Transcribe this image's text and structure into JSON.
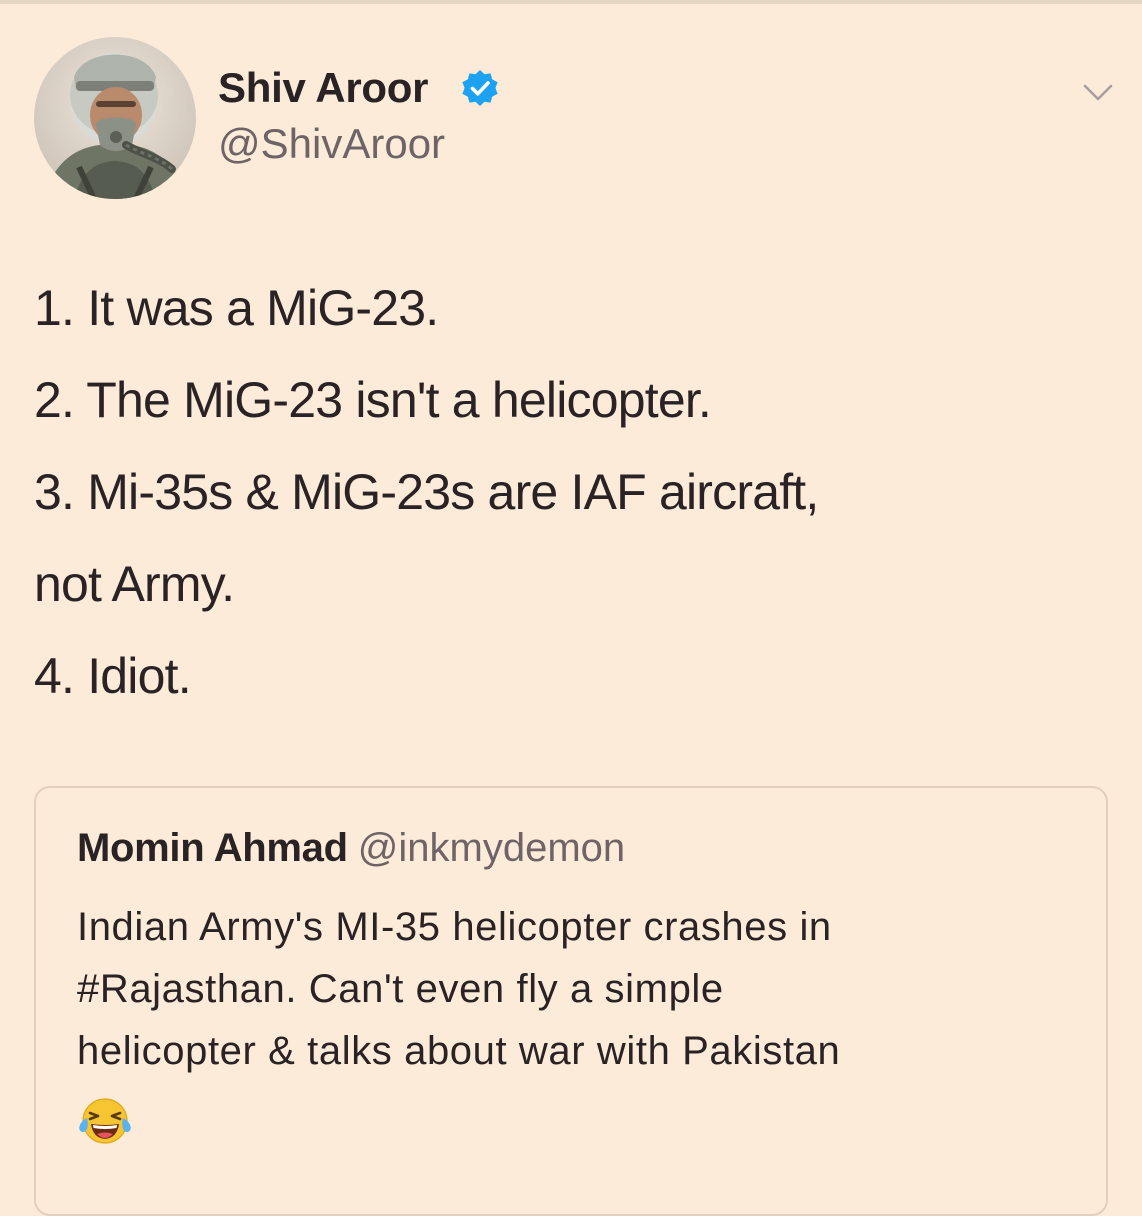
{
  "tweet": {
    "author": {
      "display_name": "Shiv Aroor",
      "handle": "@ShivAroor",
      "verified": true,
      "avatar": "pilot-avatar"
    },
    "menu_icon": "chevron-down-icon",
    "lines": [
      "1. It was a MiG-23.",
      "2. The MiG-23 isn't a helicopter.",
      "3. Mi-35s & MiG-23s are IAF aircraft,",
      "not Army.",
      "4. Idiot."
    ]
  },
  "quoted_tweet": {
    "display_name": "Momin Ahmad",
    "handle": "@inkmydemon",
    "lines": [
      "Indian Army's MI-35 helicopter crashes in",
      "#Rajasthan. Can't even fly a simple",
      "helicopter & talks about war with Pakistan"
    ],
    "emoji": "face-with-tears-of-joy"
  },
  "colors": {
    "background": "#fcebd8",
    "text": "#2a2326",
    "secondary_text": "#6e6468",
    "verified_blue": "#1da1f2",
    "border": "#e3d0bc"
  }
}
